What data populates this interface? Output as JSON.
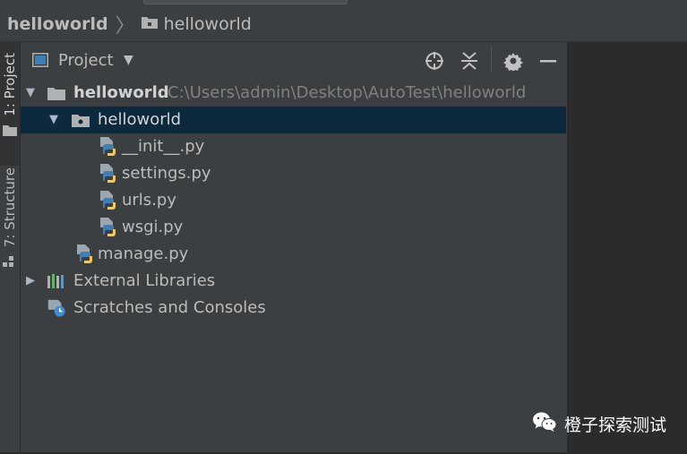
{
  "breadcrumb": {
    "root": "helloworld",
    "separator": "〉",
    "child": "helloworld"
  },
  "sidebar": {
    "tabs": [
      {
        "label": "1: Project",
        "active": true
      },
      {
        "label": "7: Structure",
        "active": false
      }
    ]
  },
  "panel": {
    "title": "Project",
    "dropdown_glyph": "▼",
    "toolbar_icons": [
      "locate-icon",
      "collapse-all-icon",
      "gear-icon",
      "hide-icon"
    ]
  },
  "tree": {
    "root": {
      "name": "helloworld",
      "path": "C:\\Users\\admin\\Desktop\\AutoTest\\helloworld"
    },
    "package": {
      "name": "helloworld"
    },
    "files": [
      {
        "name": "__init__.py"
      },
      {
        "name": "settings.py"
      },
      {
        "name": "urls.py"
      },
      {
        "name": "wsgi.py"
      }
    ],
    "manage": {
      "name": "manage.py"
    },
    "external_libraries": "External Libraries",
    "scratches": "Scratches and Consoles",
    "expand_glyph": "▼",
    "collapsed_glyph": "▶"
  },
  "watermark": {
    "text": "橙子探索测试"
  },
  "colors": {
    "panel_bg": "#3c3f41",
    "editor_bg": "#2b2b2b",
    "selected_row": "#0d293e",
    "text": "#bbbbbb",
    "path_text": "#808080",
    "folder_icon": "#afb1b3",
    "python_blue": "#3f7fb6",
    "python_yellow": "#f7c948"
  }
}
